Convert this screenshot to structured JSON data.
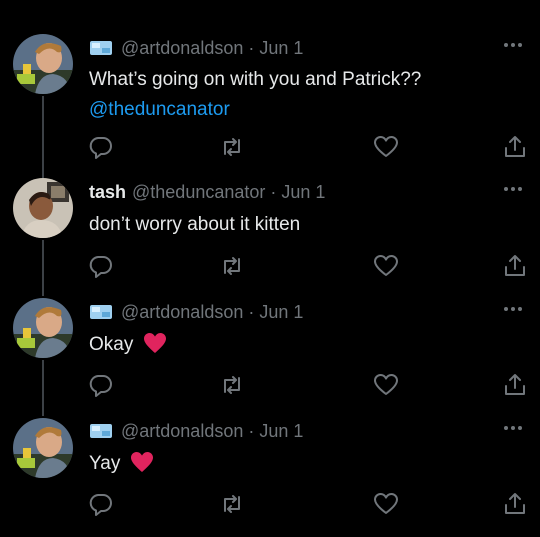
{
  "tweets": [
    {
      "display_name": "",
      "handle": "@artdonaldson",
      "separator": "·",
      "date": "Jun 1",
      "text": "What’s going on with you and Patrick??",
      "mention": "@theduncanator",
      "emoji": ""
    },
    {
      "display_name": "tash",
      "handle": "@theduncanator",
      "separator": "·",
      "date": "Jun 1",
      "text": "don’t worry about it kitten",
      "mention": "",
      "emoji": ""
    },
    {
      "display_name": "",
      "handle": "@artdonaldson",
      "separator": "·",
      "date": "Jun 1",
      "text": "Okay",
      "mention": "",
      "emoji": "red-heart"
    },
    {
      "display_name": "",
      "handle": "@artdonaldson",
      "separator": "·",
      "date": "Jun 1",
      "text": "Yay",
      "mention": "",
      "emoji": "red-heart"
    }
  ],
  "icons": {
    "reply": "reply-icon",
    "retweet": "retweet-icon",
    "like": "like-icon",
    "share": "share-icon",
    "more": "more-icon",
    "name_glyph": "ice-cube-emoji"
  },
  "colors": {
    "background": "#000000",
    "text": "#e7e9ea",
    "muted": "#71767b",
    "link": "#1d9bf0",
    "heart": "#e0245e"
  }
}
